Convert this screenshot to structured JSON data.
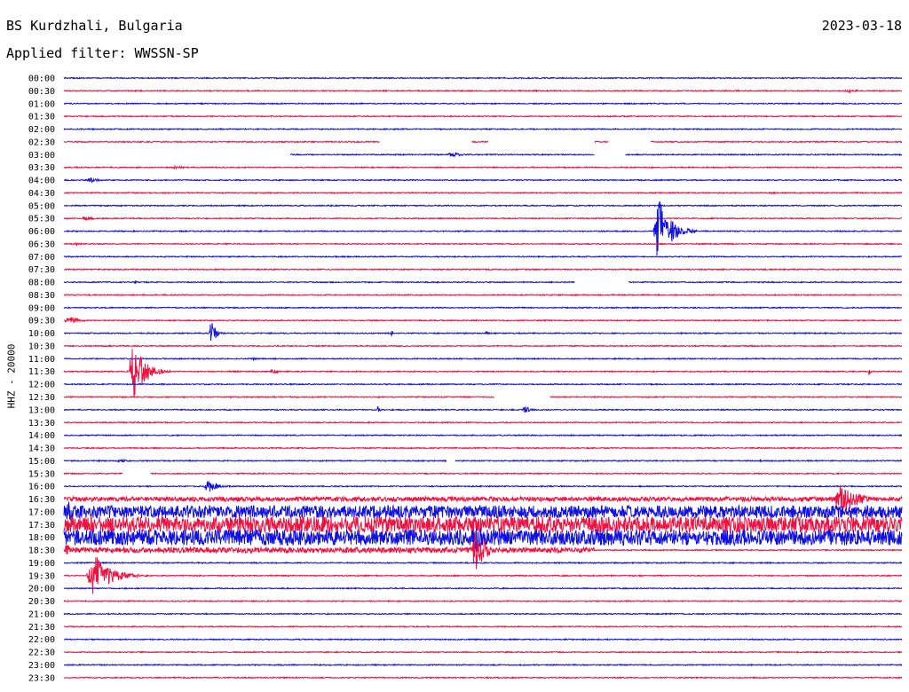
{
  "header": {
    "station": "BS Kurdzhali, Bulgaria",
    "date": "2023-03-18",
    "filter": "Applied filter: WWSSN-SP",
    "channel": "HHZ - 20000"
  },
  "colors": {
    "odd": "#1010e0",
    "even": "#f01040"
  },
  "chart_data": {
    "type": "line",
    "title": "BS Kurdzhali, Bulgaria",
    "ylabel": "HHZ - 20000",
    "rows": [
      "00:00",
      "00:30",
      "01:00",
      "01:30",
      "02:00",
      "02:30",
      "03:00",
      "03:30",
      "04:00",
      "04:30",
      "05:00",
      "05:30",
      "06:00",
      "06:30",
      "07:00",
      "07:30",
      "08:00",
      "08:30",
      "09:00",
      "09:30",
      "10:00",
      "10:30",
      "11:00",
      "11:30",
      "12:00",
      "12:30",
      "13:00",
      "13:30",
      "14:00",
      "14:30",
      "15:00",
      "15:30",
      "16:00",
      "16:30",
      "17:00",
      "17:30",
      "18:00",
      "18:30",
      "19:00",
      "19:30",
      "20:00",
      "20:30",
      "21:00",
      "21:30",
      "22:00",
      "22:30",
      "23:00",
      "23:30"
    ],
    "row_minutes": 30,
    "gaps": [
      {
        "row": "02:30",
        "from_min": 11.3,
        "to_min": 14.6
      },
      {
        "row": "02:30",
        "from_min": 15.2,
        "to_min": 19.0
      },
      {
        "row": "02:30",
        "from_min": 19.5,
        "to_min": 21.0
      },
      {
        "row": "03:00",
        "from_min": 0.0,
        "to_min": 8.1
      },
      {
        "row": "03:00",
        "from_min": 19.0,
        "to_min": 20.1
      },
      {
        "row": "08:00",
        "from_min": 18.3,
        "to_min": 20.2
      },
      {
        "row": "12:30",
        "from_min": 15.4,
        "to_min": 17.4
      },
      {
        "row": "15:00",
        "from_min": 13.7,
        "to_min": 14.0
      },
      {
        "row": "15:30",
        "from_min": 2.1,
        "to_min": 3.1
      }
    ],
    "events": [
      {
        "row": "00:30",
        "start_min": 27.9,
        "amp": 2,
        "dur_min": 1.5
      },
      {
        "row": "01:00",
        "start_min": 3.9,
        "amp": 2,
        "dur_min": 0.2
      },
      {
        "row": "03:00",
        "start_min": 13.7,
        "amp": 3,
        "dur_min": 1.5
      },
      {
        "row": "03:30",
        "start_min": 3.8,
        "amp": 2,
        "dur_min": 1.5
      },
      {
        "row": "04:00",
        "start_min": 0.8,
        "amp": 3,
        "dur_min": 1.3
      },
      {
        "row": "05:30",
        "start_min": 0.6,
        "amp": 3,
        "dur_min": 1.2
      },
      {
        "row": "06:00",
        "start_min": 21.1,
        "amp": 42,
        "dur_min": 1.6
      },
      {
        "row": "06:30",
        "start_min": 0.3,
        "amp": 2,
        "dur_min": 1.0
      },
      {
        "row": "08:00",
        "start_min": 2.5,
        "amp": 2,
        "dur_min": 0.4
      },
      {
        "row": "09:30",
        "start_min": 0.0,
        "amp": 5,
        "dur_min": 1.3
      },
      {
        "row": "10:00",
        "start_min": 5.2,
        "amp": 18,
        "dur_min": 0.6
      },
      {
        "row": "10:00",
        "start_min": 11.7,
        "amp": 4,
        "dur_min": 0.2
      },
      {
        "row": "10:00",
        "start_min": 15.1,
        "amp": 3,
        "dur_min": 0.2
      },
      {
        "row": "11:00",
        "start_min": 6.7,
        "amp": 2,
        "dur_min": 0.7
      },
      {
        "row": "11:30",
        "start_min": 2.3,
        "amp": 38,
        "dur_min": 1.5
      },
      {
        "row": "11:30",
        "start_min": 7.4,
        "amp": 4,
        "dur_min": 0.6
      },
      {
        "row": "11:30",
        "start_min": 28.8,
        "amp": 4,
        "dur_min": 0.2
      },
      {
        "row": "13:00",
        "start_min": 11.2,
        "amp": 4,
        "dur_min": 0.3
      },
      {
        "row": "13:00",
        "start_min": 16.4,
        "amp": 6,
        "dur_min": 0.7
      },
      {
        "row": "15:00",
        "start_min": 1.8,
        "amp": 2,
        "dur_min": 1.5
      },
      {
        "row": "15:00",
        "start_min": 24.9,
        "amp": 3,
        "dur_min": 0.2
      },
      {
        "row": "16:00",
        "start_min": 5.0,
        "amp": 8,
        "dur_min": 1.3
      },
      {
        "row": "16:30",
        "start_min": 27.5,
        "amp": 18,
        "dur_min": 2.5
      },
      {
        "row": "17:00",
        "start_min": 0.0,
        "amp": 15,
        "dur_min": 1.2
      },
      {
        "row": "18:00",
        "start_min": 14.6,
        "amp": 18,
        "dur_min": 1.2
      },
      {
        "row": "18:30",
        "start_min": 0.0,
        "amp": 8,
        "dur_min": 0.6
      },
      {
        "row": "18:30",
        "start_min": 14.6,
        "amp": 30,
        "dur_min": 1.2
      },
      {
        "row": "19:30",
        "start_min": 0.8,
        "amp": 26,
        "dur_min": 2.2
      },
      {
        "row": "20:00",
        "start_min": 11.1,
        "amp": 3,
        "dur_min": 0.2
      },
      {
        "row": "21:00",
        "start_min": 9.4,
        "amp": 2,
        "dur_min": 0.3
      }
    ],
    "noisy": [
      {
        "row": "16:30",
        "from_min": 0.0,
        "to_min": 30.0,
        "amp": 2.5
      },
      {
        "row": "17:00",
        "from_min": 0.0,
        "to_min": 30.0,
        "amp": 7
      },
      {
        "row": "17:30",
        "from_min": 0.0,
        "to_min": 30.0,
        "amp": 9
      },
      {
        "row": "18:00",
        "from_min": 0.0,
        "to_min": 30.0,
        "amp": 9
      },
      {
        "row": "18:30",
        "from_min": 0.0,
        "to_min": 19.0,
        "amp": 3
      }
    ]
  }
}
